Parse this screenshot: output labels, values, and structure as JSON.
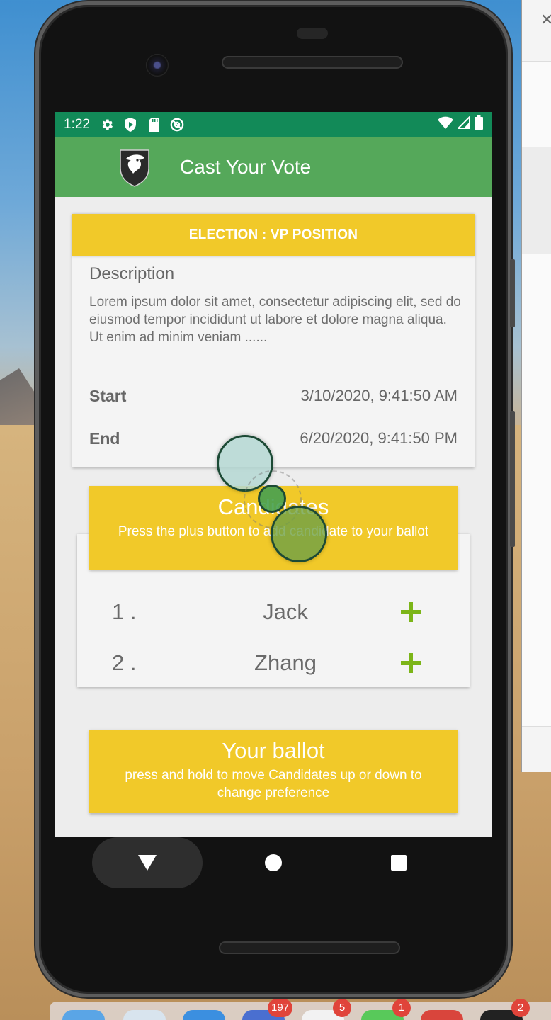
{
  "status_bar": {
    "time": "1:22",
    "left_icons": [
      "gear-icon",
      "shield-play-icon",
      "sd-card-icon",
      "at-sign-icon"
    ],
    "right_icons": [
      "wifi-icon",
      "signal-icon",
      "battery-icon"
    ]
  },
  "app_bar": {
    "title": "Cast Your Vote",
    "logo": "eagle-shield-logo"
  },
  "election": {
    "header": "ELECTION : VP POSITION",
    "description_label": "Description",
    "description_text": "Lorem ipsum dolor sit amet, consectetur adipiscing elit, sed do eiusmod tempor incididunt ut labore et dolore magna aliqua. Ut enim ad minim veniam ......",
    "start_label": "Start",
    "start_value": "3/10/2020, 9:41:50 AM",
    "end_label": "End",
    "end_value": "6/20/2020, 9:41:50 PM"
  },
  "candidates_section": {
    "title": "Candidates",
    "subtitle": "Press the plus button to add candidate to your ballot",
    "items": [
      {
        "number": "1 .",
        "name": "Jack"
      },
      {
        "number": "2 .",
        "name": "Zhang"
      }
    ],
    "add_icon": "plus-icon"
  },
  "ballot_section": {
    "title": "Your ballot",
    "subtitle": "press and hold to move Candidates up or down to change preference"
  },
  "nav_bar": {
    "icons": [
      "back-triangle-icon",
      "home-circle-icon",
      "recents-square-icon"
    ]
  },
  "dock": {
    "badges": [
      "197",
      "5",
      "1",
      "2"
    ]
  },
  "colors": {
    "status_bar": "#128a58",
    "app_bar": "#55a85a",
    "accent_yellow": "#f1c929",
    "plus_green": "#7cb518"
  }
}
